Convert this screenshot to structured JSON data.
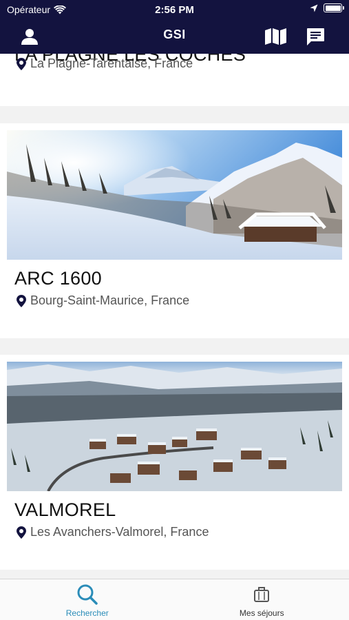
{
  "status_bar": {
    "carrier": "Opérateur",
    "time": "2:56 PM"
  },
  "nav": {
    "title": "GSI"
  },
  "cards": [
    {
      "name": "LA PLAGNE LES COCHES",
      "location": "La Plagne-Tarentaise, France"
    },
    {
      "name": "ARC 1600",
      "location": "Bourg-Saint-Maurice, France"
    },
    {
      "name": "VALMOREL",
      "location": "Les Avanchers-Valmorel, France"
    }
  ],
  "tabbar": {
    "search_label": "Rechercher",
    "stays_label": "Mes séjours",
    "active_color": "#2a8cb8"
  },
  "colors": {
    "nav_bg": "#13133f",
    "accent": "#2a8cb8"
  }
}
